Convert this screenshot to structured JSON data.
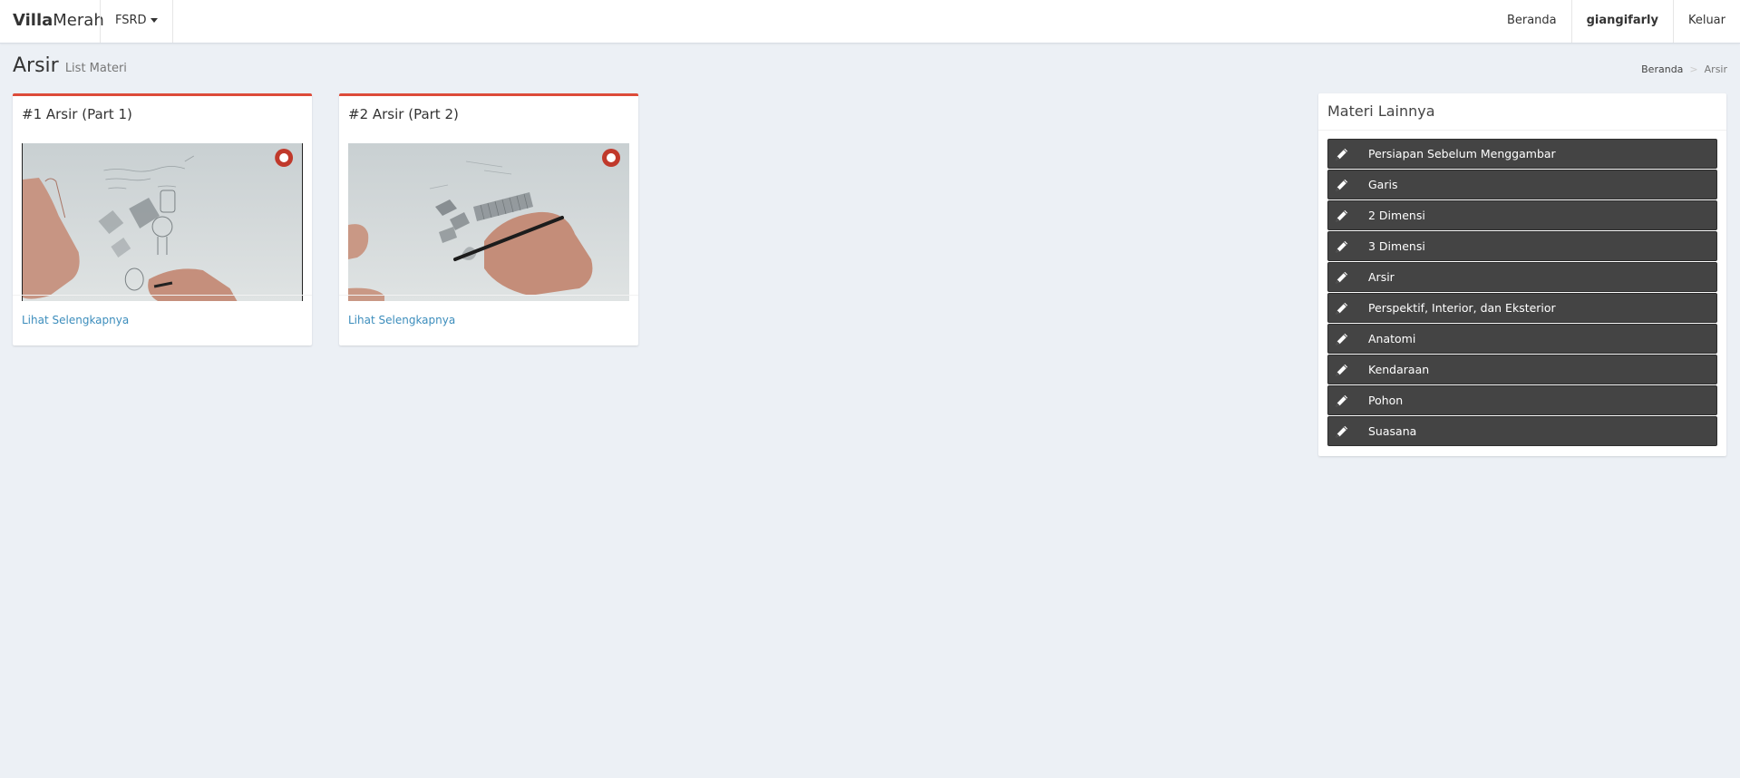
{
  "navbar": {
    "brand_bold": "Villa",
    "brand_rest": "Merah",
    "dropdown_label": "FSRD",
    "links": [
      "Beranda",
      "giangifarly",
      "Keluar"
    ]
  },
  "header": {
    "title": "Arsir",
    "subtitle": "List Materi"
  },
  "breadcrumb": {
    "home": "Beranda",
    "separator": ">",
    "current": "Arsir"
  },
  "cards": [
    {
      "title": "#1 Arsir (Part 1)",
      "link_text": "Lihat Selengkapnya"
    },
    {
      "title": "#2 Arsir (Part 2)",
      "link_text": "Lihat Selengkapnya"
    }
  ],
  "sidebar": {
    "title": "Materi Lainnya",
    "items": [
      "Persiapan Sebelum Menggambar",
      "Garis",
      "2 Dimensi",
      "3 Dimensi",
      "Arsir",
      "Perspektif, Interior, dan Eksterior",
      "Anatomi",
      "Kendaraan",
      "Pohon",
      "Suasana"
    ],
    "item_icon": "pencil-icon"
  },
  "colors": {
    "accent": "#dd4b39",
    "link": "#3c8dbc",
    "list_bg": "#444444",
    "page_bg": "#ecf0f5"
  }
}
